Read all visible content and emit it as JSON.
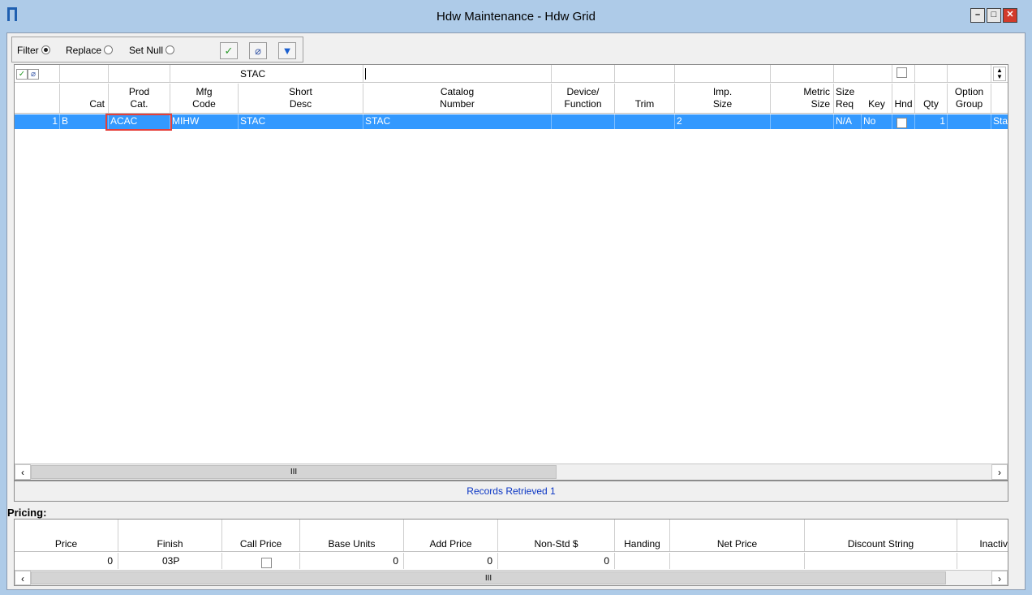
{
  "window": {
    "title": "Hdw Maintenance - Hdw Grid",
    "min_label": "–",
    "max_label": "□",
    "close_label": "✕"
  },
  "toolbar": {
    "filter_label": "Filter",
    "replace_label": "Replace",
    "setnull_label": "Set Null",
    "mode_selected": "Filter",
    "buttons": [
      {
        "icon": "check-icon",
        "glyph": "✓"
      },
      {
        "icon": "eraser-icon",
        "glyph": "⌀"
      },
      {
        "icon": "funnel-icon",
        "glyph": "▼"
      }
    ]
  },
  "grid": {
    "filter_row": {
      "short_desc_value": "STAC"
    },
    "columns": [
      {
        "key": "rownum",
        "label": ""
      },
      {
        "key": "cat",
        "label": "Cat"
      },
      {
        "key": "prod_cat",
        "label": "Prod\nCat."
      },
      {
        "key": "mfg_code",
        "label": "Mfg\nCode"
      },
      {
        "key": "short_desc",
        "label": "Short\nDesc"
      },
      {
        "key": "catalog_number",
        "label": "Catalog\nNumber"
      },
      {
        "key": "device_function",
        "label": "Device/\nFunction"
      },
      {
        "key": "trim",
        "label": "Trim"
      },
      {
        "key": "imp_size",
        "label": "Imp.\nSize"
      },
      {
        "key": "metric_size",
        "label": "Metric\nSize"
      },
      {
        "key": "size_req",
        "label": "Size\nReq"
      },
      {
        "key": "key",
        "label": "Key"
      },
      {
        "key": "hnd",
        "label": "Hnd"
      },
      {
        "key": "qty",
        "label": "Qty"
      },
      {
        "key": "option_group",
        "label": "Option\nGroup"
      },
      {
        "key": "extra",
        "label": ""
      }
    ],
    "rows": [
      {
        "rownum": "1",
        "cat": "B",
        "prod_cat": "ACAC",
        "mfg_code": "MIHW",
        "short_desc": "STAC",
        "catalog_number": "STAC",
        "device_function": "",
        "trim": "",
        "imp_size": "2",
        "metric_size": "",
        "size_req": "N/A",
        "key": "No",
        "hnd_checked": false,
        "qty": "1",
        "option_group": "",
        "extra": "Stall"
      }
    ],
    "scroll_thumb_label": "III"
  },
  "status": {
    "text": "Records Retrieved 1"
  },
  "pricing": {
    "label": "Pricing:",
    "columns": [
      "Price",
      "Finish",
      "Call Price",
      "Base Units",
      "Add Price",
      "Non-Std $",
      "Handing",
      "Net Price",
      "Discount String",
      "Inactiv"
    ],
    "row": {
      "price": "0",
      "finish": "03P",
      "call_price_checked": false,
      "base_units": "0",
      "add_price": "0",
      "non_std": "0",
      "handing": "",
      "net_price": "",
      "discount_string": "",
      "inactive": ""
    },
    "scroll_thumb_label": "III"
  },
  "colors": {
    "selection": "#3399ff",
    "highlight_box": "#e5403a",
    "status_text": "#0b36c4",
    "titlebar": "#aecbe8"
  }
}
